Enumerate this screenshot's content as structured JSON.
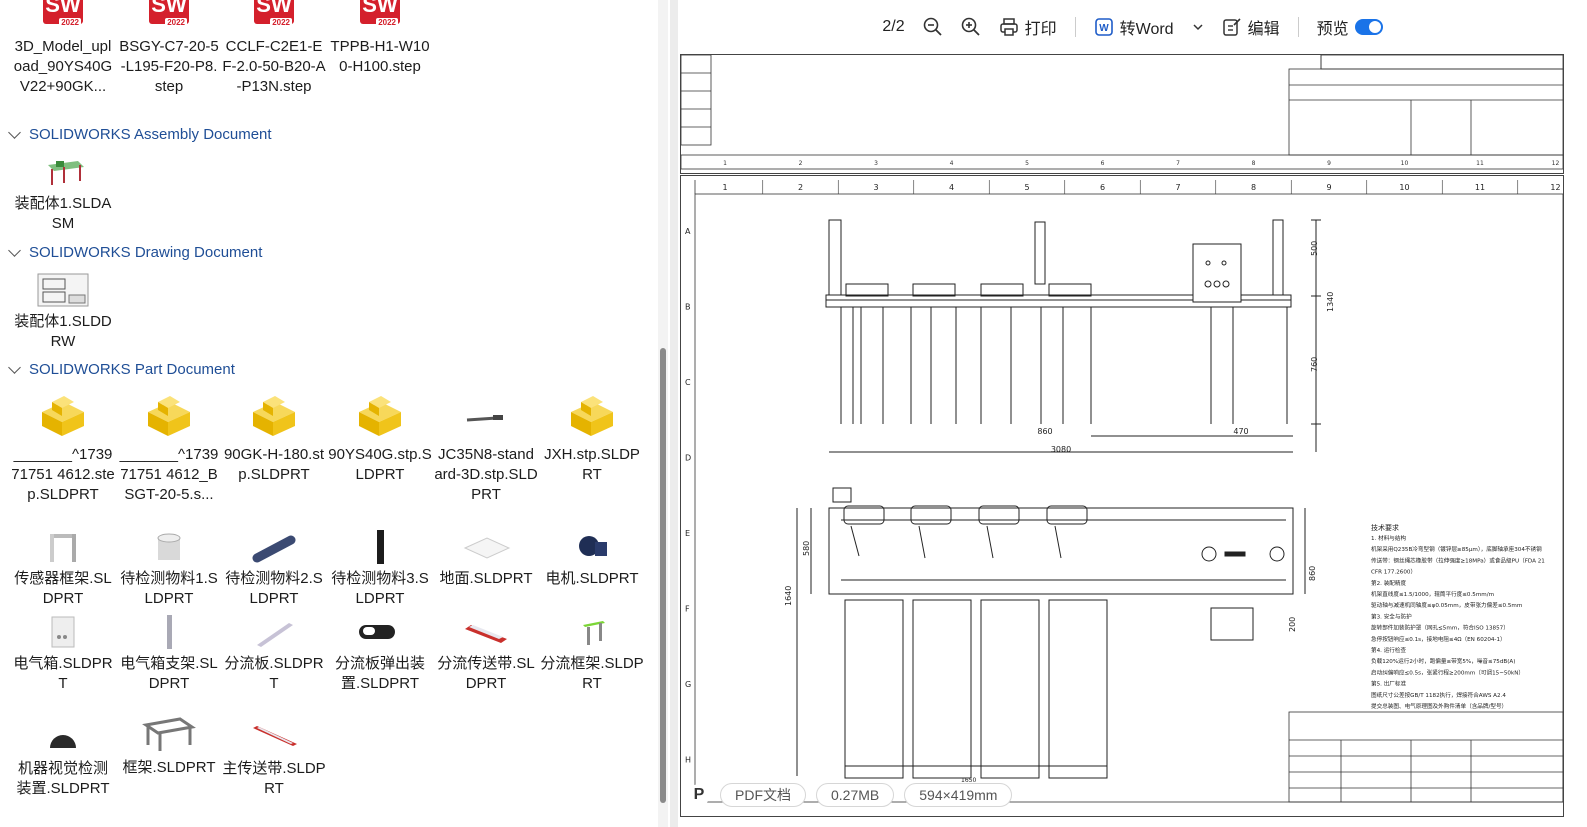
{
  "toolbar": {
    "page": "2/2",
    "print": "打印",
    "to_word": "转Word",
    "edit": "编辑",
    "preview": "预览"
  },
  "top_row": [
    {
      "name": "3D_Model_upload_90YS40GV22+90GK..."
    },
    {
      "name": "BSGY-C7-20-5-L195-F20-P8.step"
    },
    {
      "name": "CCLF-C2E1-EF-2.0-50-B20-A-P13N.step"
    },
    {
      "name": "TPPB-H1-W100-H100.step"
    }
  ],
  "groups": {
    "assembly": "SOLIDWORKS Assembly Document",
    "drawing": "SOLIDWORKS Drawing Document",
    "part": "SOLIDWORKS Part Document"
  },
  "assembly_files": [
    {
      "name": "装配体1.SLDASM"
    }
  ],
  "drawing_files": [
    {
      "name": "装配体1.SLDDRW"
    }
  ],
  "part_files_row1": [
    {
      "name": "_______^173971751 4612.step.SLDPRT"
    },
    {
      "name": "_______^173971751 4612_BSGT-20-5.s..."
    },
    {
      "name": "90GK-H-180.stp.SLDPRT"
    },
    {
      "name": "90YS40G.stp.SLDPRT"
    },
    {
      "name": "JC35N8-standard-3D.stp.SLDPRT"
    },
    {
      "name": "JXH.stp.SLDPRT"
    }
  ],
  "part_files_row2": [
    {
      "name": "传感器框架.SLDPRT"
    },
    {
      "name": "待检测物料1.SLDPRT"
    },
    {
      "name": "待检测物料2.SLDPRT"
    },
    {
      "name": "待检测物料3.SLDPRT"
    },
    {
      "name": "地面.SLDPRT"
    },
    {
      "name": "电机.SLDPRT"
    }
  ],
  "part_files_row3": [
    {
      "name": "电气箱.SLDPRT"
    },
    {
      "name": "电气箱支架.SLDPRT"
    },
    {
      "name": "分流板.SLDPRT"
    },
    {
      "name": "分流板弹出装置.SLDPRT"
    },
    {
      "name": "分流传送带.SLDPRT"
    },
    {
      "name": "分流框架.SLDPRT"
    }
  ],
  "part_files_row4": [
    {
      "name": "机器视觉检测装置.SLDPRT"
    },
    {
      "name": "框架.SLDPRT"
    },
    {
      "name": "主传送带.SLDPRT"
    }
  ],
  "drawing": {
    "cols": [
      "1",
      "2",
      "3",
      "4",
      "5",
      "6",
      "7",
      "8",
      "9",
      "10",
      "11",
      "12"
    ],
    "rows": [
      "A",
      "B",
      "C",
      "D",
      "E",
      "F",
      "G",
      "H"
    ],
    "dims": {
      "d500": "500",
      "d1340": "1340",
      "d760": "760",
      "d860": "860",
      "d470": "470",
      "d3080": "3080",
      "d580": "580",
      "d1640": "1640",
      "d860b": "860",
      "d200": "200",
      "d1650": "1650"
    },
    "notes_title": "技术要求",
    "notes": [
      "1. 材料与结构",
      "机架采用Q235B冷弯型钢（镀锌层≥85μm），底脚轴承座304不锈钢",
      "传送带：钢丝绳芯橡胶带（拉伸强度≥18MPa）或食品级PU（FDA 21",
      "CFR 177.2600）",
      "第2. 装配精度",
      "机架直线度≤1.5/1000，辊筒平行度≤0.5mm/m",
      "驱动轴与减速机同轴度≤φ0.05mm，皮带张力偏差≤0.5mm",
      "第3. 安全与防护",
      "旋转部件加装防护罩（网孔≤5mm，符合ISO 13857）",
      "急停按钮响应≤0.1s，接地电阻≤4Ω（EN 60204-1）",
      "第4. 运行检查",
      "负载120%运行2小时，跑偏量≤带宽5%，噪音≤75dB(A)",
      "启动纠偏响应≤0.5s，张紧行程≥200mm（可调15~50kN）",
      "第5. 出厂标准",
      "图纸尺寸公差按GB/T 1182执行，焊接符合AWS A2.4",
      "提交总装图、电气原理图及外购件清单（含品牌/型号）"
    ]
  },
  "status": {
    "doc_type": "PDF文档",
    "size": "0.27MB",
    "paper": "594×419mm"
  }
}
